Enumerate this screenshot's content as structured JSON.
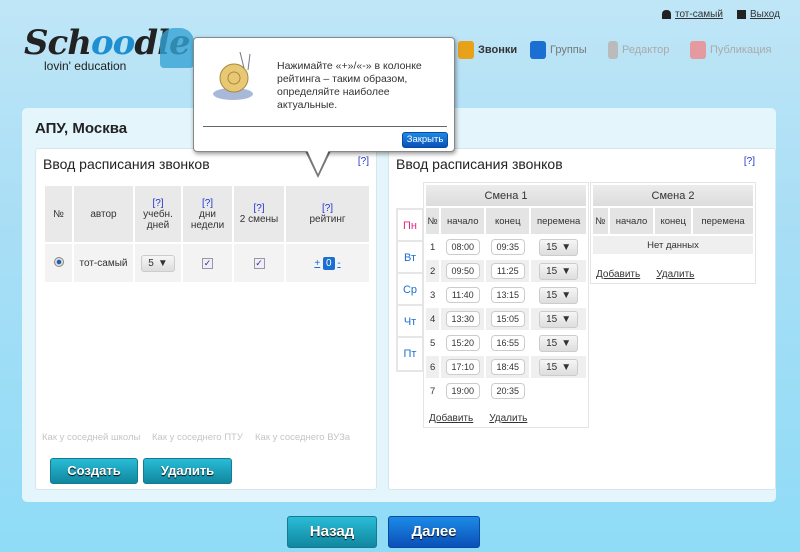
{
  "header": {
    "user": "тот-самый",
    "logout": "Выход",
    "logo_text": "Schoodle",
    "logo_tagline": "lovin' education",
    "nav": [
      {
        "label": "Звонки",
        "icon": "bell-icon",
        "active": true
      },
      {
        "label": "Группы",
        "icon": "notebook-icon",
        "active": false
      },
      {
        "label": "Редактор",
        "icon": "pen-icon",
        "active": false
      },
      {
        "label": "Публикация",
        "icon": "megaphone-icon",
        "active": false
      }
    ]
  },
  "popup": {
    "text": "Нажимайте «+»/«-» в колонке рейтинга – таким образом, определяйте наиболее актуальные.",
    "close": "Закрыть"
  },
  "page_title": "АПУ, Москва",
  "left": {
    "title": "Ввод расписания звонков",
    "help": "[?]",
    "columns": [
      "№",
      "автор",
      "учебн. дней",
      "дни недели",
      "2 смены",
      "рейтинг"
    ],
    "rows": [
      {
        "author": "тот-самый",
        "days": "5",
        "weekdays": true,
        "two_shifts": true,
        "rating": "0",
        "plus": "+",
        "minus": "-",
        "selected": true
      }
    ],
    "presets": [
      "Как у соседней школы",
      "Как у соседнего ПТУ",
      "Как у соседнего ВУЗа"
    ],
    "create": "Создать",
    "delete": "Удалить"
  },
  "right": {
    "title": "Ввод расписания звонков",
    "help": "[?]",
    "days": [
      "Пн",
      "Вт",
      "Ср",
      "Чт",
      "Пт"
    ],
    "active_day": "Пн",
    "columns": [
      "№",
      "начало",
      "конец",
      "перемена"
    ],
    "shift1": {
      "title": "Смена 1",
      "rows": [
        {
          "n": "1",
          "start": "08:00",
          "end": "09:35",
          "break": "15"
        },
        {
          "n": "2",
          "start": "09:50",
          "end": "11:25",
          "break": "15"
        },
        {
          "n": "3",
          "start": "11:40",
          "end": "13:15",
          "break": "15"
        },
        {
          "n": "4",
          "start": "13:30",
          "end": "15:05",
          "break": "15"
        },
        {
          "n": "5",
          "start": "15:20",
          "end": "16:55",
          "break": "15"
        },
        {
          "n": "6",
          "start": "17:10",
          "end": "18:45",
          "break": "15"
        },
        {
          "n": "7",
          "start": "19:00",
          "end": "20:35",
          "break": ""
        }
      ]
    },
    "shift2": {
      "title": "Смена 2",
      "empty": "Нет данных"
    },
    "add": "Добавить",
    "remove": "Удалить"
  },
  "footer": {
    "back": "Назад",
    "next": "Далее"
  },
  "colors": {
    "accent_teal": "#1aa3bf",
    "accent_blue": "#1470d6",
    "active_day": "#e0287d",
    "day_link": "#1a6fd0"
  }
}
